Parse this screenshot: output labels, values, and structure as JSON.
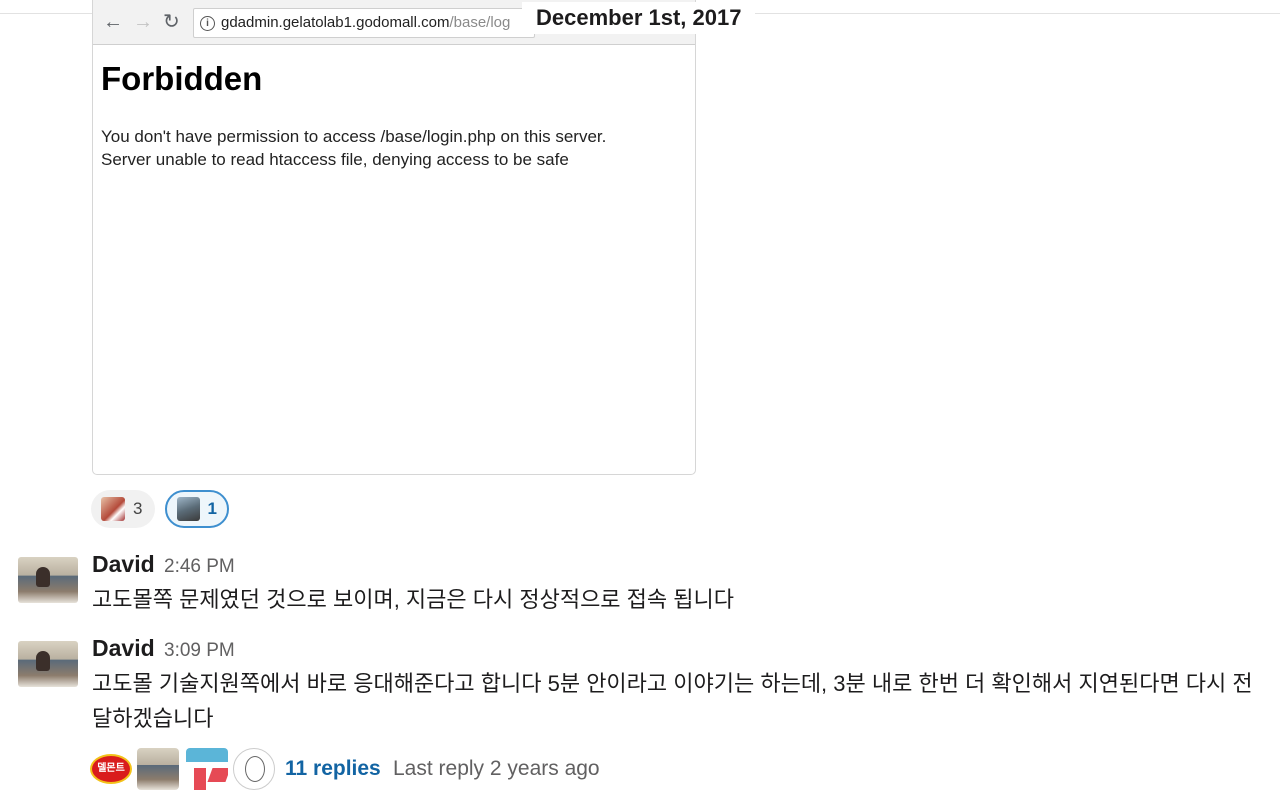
{
  "date_divider": "December 1st, 2017",
  "attachment": {
    "url_host": "gdadmin.gelatolab1.godomall.com",
    "url_path": "/base/log",
    "heading": "Forbidden",
    "line1": "You don't have permission to access /base/login.php on this server.",
    "line2": "Server unable to read htaccess file, denying access to be safe"
  },
  "reactions": [
    {
      "emoji": "face-emoji",
      "count": "3"
    },
    {
      "emoji": "person-emoji",
      "count": "1"
    }
  ],
  "messages": [
    {
      "sender": "David",
      "time": "2:46 PM",
      "text": "고도몰쪽 문제였던 것으로 보이며, 지금은 다시 정상적으로 접속 됩니다"
    },
    {
      "sender": "David",
      "time": "3:09 PM",
      "text": "고도몰 기술지원쪽에서 바로 응대해준다고 합니다 5분 안이라고 이야기는 하는데, 3분 내로 한번 더 확인해서 지연된다면 다시 전달하겠습니다"
    }
  ],
  "thread": {
    "participant_logo_text": "델몬트",
    "replies": "11 replies",
    "last_reply": "Last reply 2 years ago"
  }
}
